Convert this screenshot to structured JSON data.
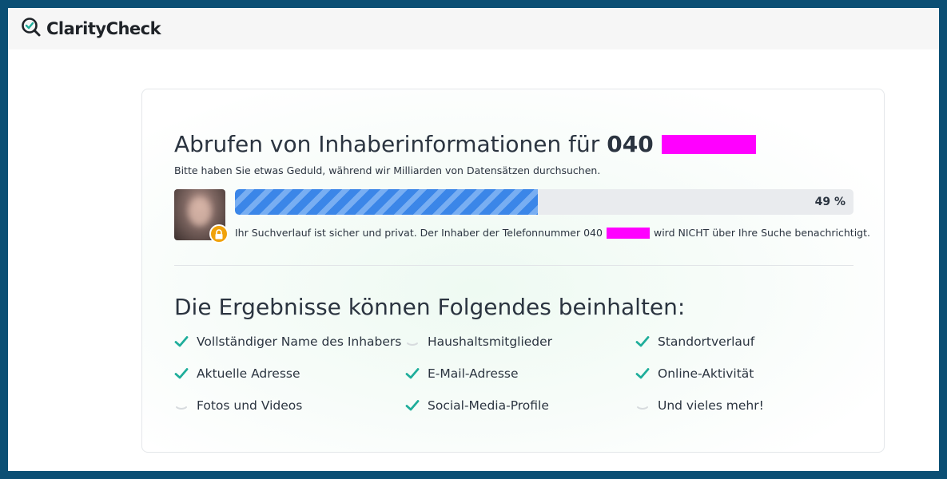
{
  "header": {
    "brand": "ClarityCheck",
    "logo_icon": "magnifier-check-icon"
  },
  "search": {
    "title_prefix": "Abrufen von Inhaberinformationen für",
    "phone_prefix": "040",
    "subtitle": "Bitte haben Sie etwas Geduld, während wir Milliarden von Datensätzen durchsuchen.",
    "progress_percent": 49,
    "progress_label": "49 %",
    "privacy_before": "Ihr Suchverlauf ist sicher und privat. Der Inhaber der Telefonnummer 040",
    "privacy_after": "wird NICHT über Ihre Suche benachrichtigt."
  },
  "results": {
    "title": "Die Ergebnisse können Folgendes beinhalten:",
    "items": [
      {
        "label": "Vollständiger Name des Inhabers",
        "status": "done"
      },
      {
        "label": "Haushaltsmitglieder",
        "status": "loading"
      },
      {
        "label": "Standortverlauf",
        "status": "done"
      },
      {
        "label": "Aktuelle Adresse",
        "status": "done"
      },
      {
        "label": "E-Mail-Adresse",
        "status": "done"
      },
      {
        "label": "Online-Aktivität",
        "status": "done"
      },
      {
        "label": "Fotos und Videos",
        "status": "loading"
      },
      {
        "label": "Social-Media-Profile",
        "status": "done"
      },
      {
        "label": "Und vieles mehr!",
        "status": "loading"
      }
    ]
  },
  "colors": {
    "frame": "#0b4f74",
    "check": "#1fae9b",
    "progress": "#3b86e8",
    "lock": "#f0a20b",
    "redaction": "#ff00ff"
  }
}
